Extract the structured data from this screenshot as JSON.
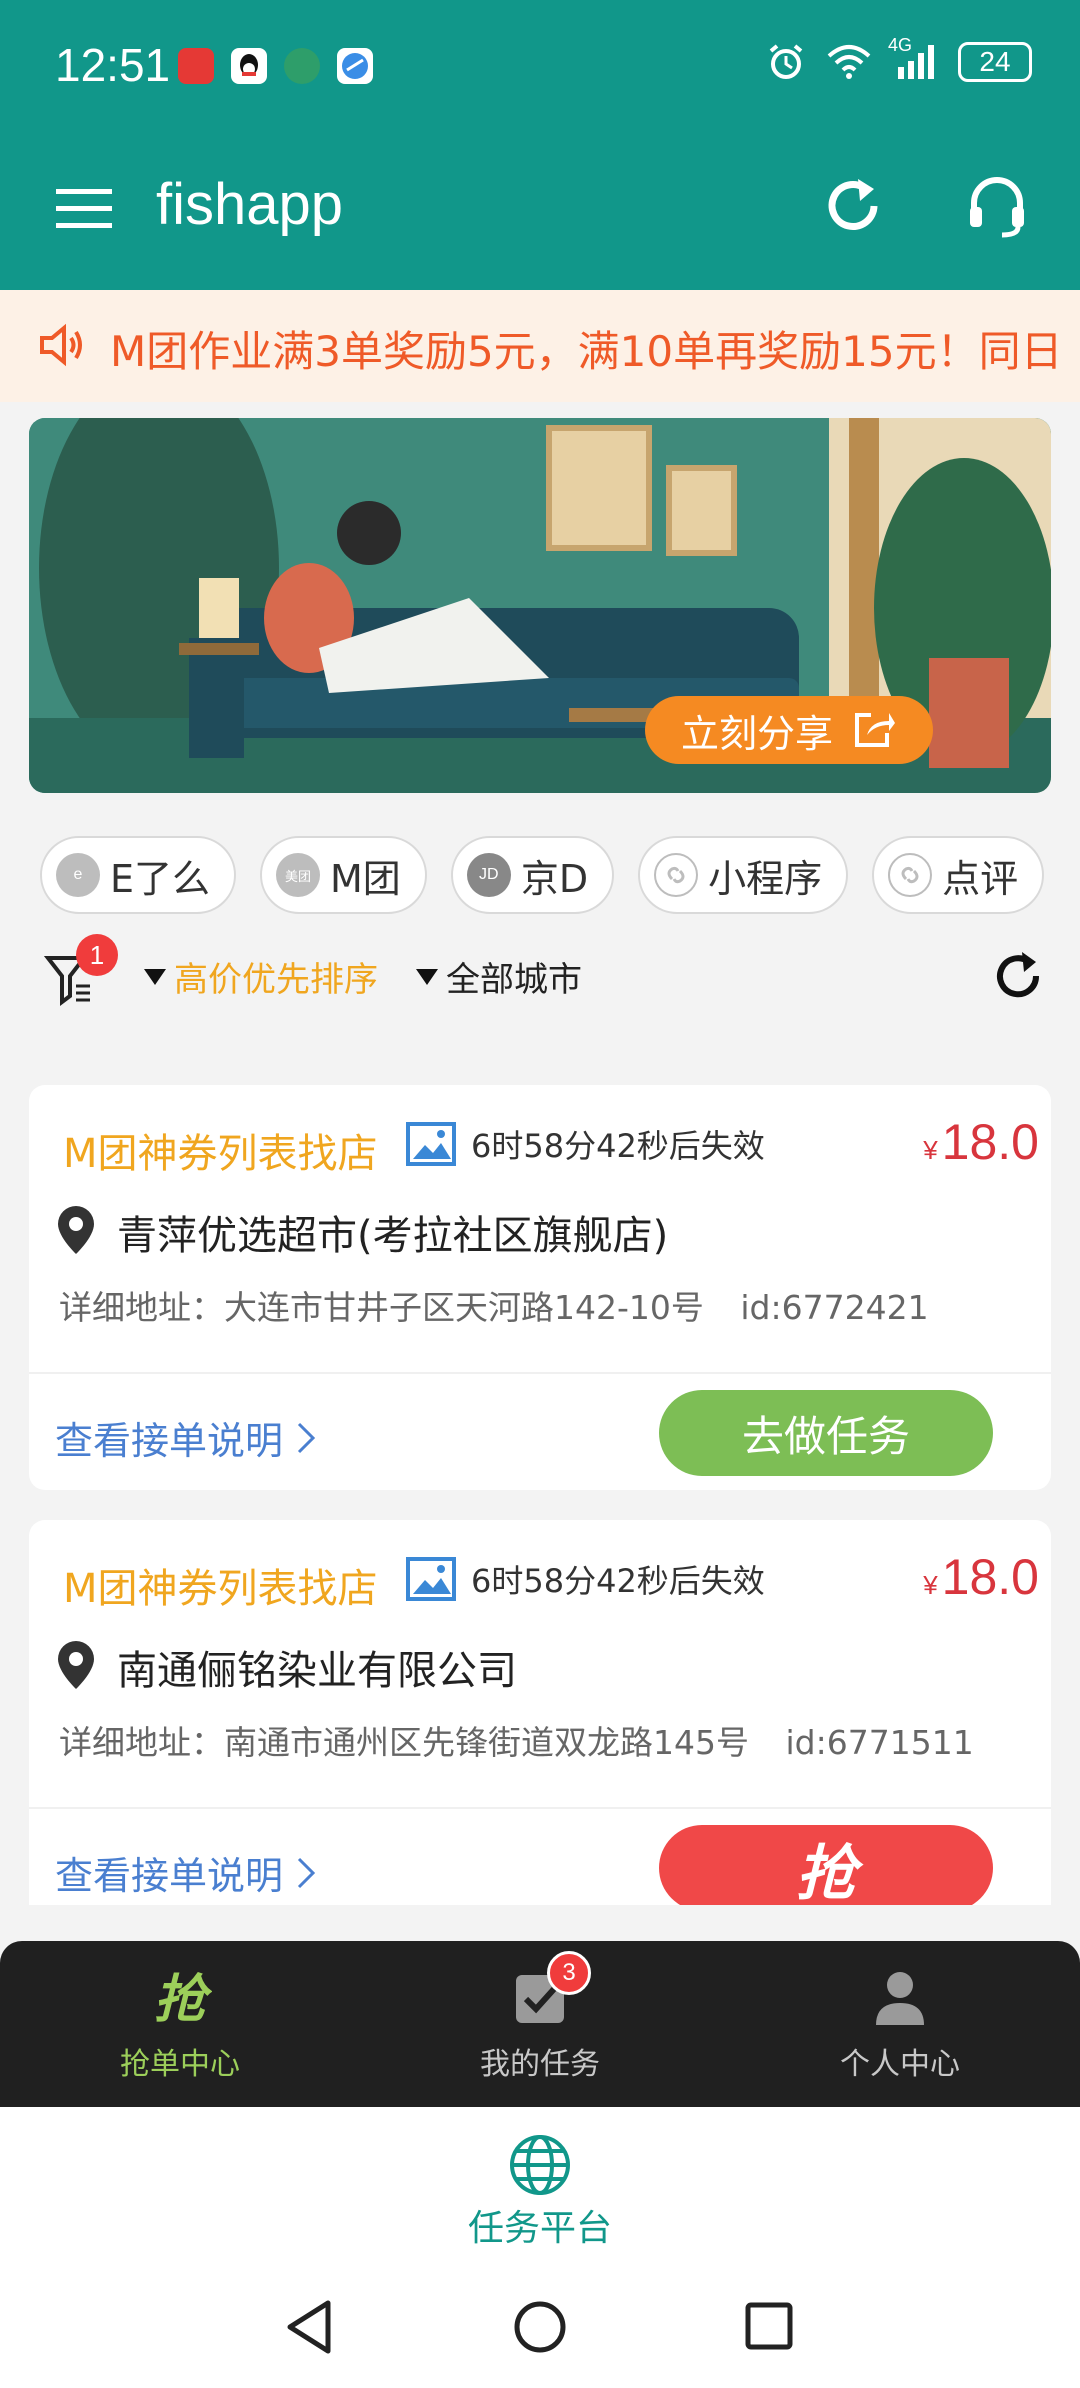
{
  "status_bar": {
    "time": "12:51",
    "network": "4G",
    "battery": "24",
    "icons": [
      "huawei-appgallery-icon",
      "qq-icon",
      "app-icon",
      "browser-icon",
      "alarm-icon",
      "wifi-icon",
      "signal-icon",
      "battery-icon"
    ]
  },
  "app_bar": {
    "title": "fishapp",
    "menu_icon": "hamburger-icon",
    "refresh_icon": "refresh-icon",
    "support_icon": "headset-icon"
  },
  "notice": {
    "icon": "speaker-icon",
    "text": "M团作业满3单奖励5元，满10单再奖励15元！同日"
  },
  "banner": {
    "share_label": "立刻分享",
    "share_icon": "share-icon"
  },
  "platforms": [
    {
      "label": "E了么",
      "icon": "eleme-icon"
    },
    {
      "label": "M团",
      "icon": "meituan-icon"
    },
    {
      "label": "京D",
      "icon": "jd-icon"
    },
    {
      "label": "小程序",
      "icon": "link-icon"
    },
    {
      "label": "点评",
      "icon": "link-icon"
    }
  ],
  "filter": {
    "badge": "1",
    "sort_label": "高价优先排序",
    "city_label": "全部城市"
  },
  "tasks": [
    {
      "title": "M团神券列表找店",
      "expire": "6时58分42秒后失效",
      "currency": "¥",
      "price": "18.0",
      "store": "青萍优选超市(考拉社区旗舰店)",
      "address": "详细地址：大连市甘井子区天河路142-10号",
      "id": "id:6772421",
      "link": "查看接单说明",
      "action": "去做任务"
    },
    {
      "title": "M团神券列表找店",
      "expire": "6时58分42秒后失效",
      "currency": "¥",
      "price": "18.0",
      "store": "南通俪铭染业有限公司",
      "address": "详细地址：南通市通州区先锋街道双龙路145号",
      "id": "id:6771511",
      "link": "查看接单说明",
      "action": "抢"
    }
  ],
  "bottom_nav": [
    {
      "label": "抢单中心",
      "icon": "grab-icon",
      "active": true
    },
    {
      "label": "我的任务",
      "icon": "task-check-icon",
      "badge": "3"
    },
    {
      "label": "个人中心",
      "icon": "person-icon"
    }
  ],
  "platform_tab": {
    "label": "任务平台",
    "icon": "globe-icon"
  },
  "colors": {
    "primary": "#11978a",
    "accent_orange": "#f0a61f",
    "price_red": "#d8353d",
    "button_green": "#7dbe55",
    "button_red": "#f04848",
    "notice_text": "#ef5a28"
  }
}
